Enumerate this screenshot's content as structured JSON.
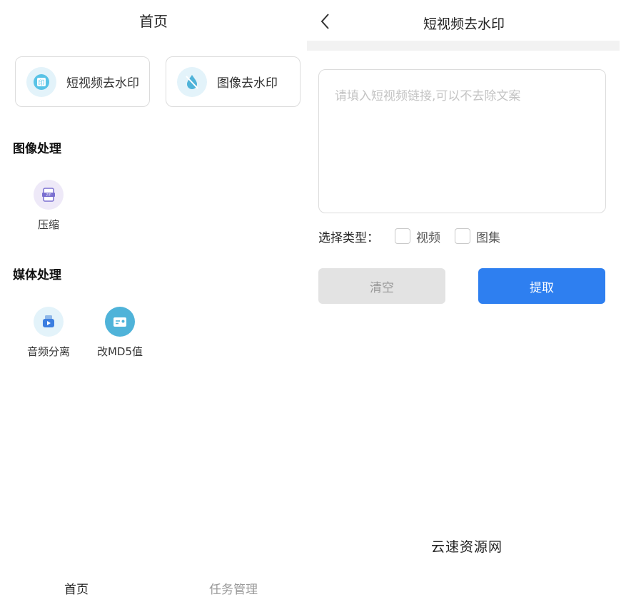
{
  "home": {
    "title": "首页",
    "cards": [
      {
        "label": "短视频去水印",
        "icon": "video-watermark-icon"
      },
      {
        "label": "图像去水印",
        "icon": "image-watermark-icon"
      }
    ],
    "sections": [
      {
        "title": "图像处理",
        "tools": [
          {
            "label": "压缩",
            "icon": "zip-compress-icon"
          }
        ]
      },
      {
        "title": "媒体处理",
        "tools": [
          {
            "label": "音频分离",
            "icon": "audio-split-icon"
          },
          {
            "label": "改MD5值",
            "icon": "md5-card-icon"
          }
        ]
      }
    ],
    "tabbar": {
      "home": "首页",
      "tasks": "任务管理"
    }
  },
  "video_watermark": {
    "title": "短视频去水印",
    "input_placeholder": "请填入短视频链接,可以不去除文案",
    "input_value": "",
    "type_label": "选择类型：",
    "types": [
      "视频",
      "图集"
    ],
    "clear_button": "清空",
    "extract_button": "提取",
    "watermark_text": "云速资源网"
  },
  "colors": {
    "primary": "#2e7ff0",
    "icon_bg_light_blue": "#e3f3fa",
    "icon_bg_lavender": "#eee9f8",
    "icon_bg_teal": "#4fb3d9",
    "disabled_button": "#e3e3e3",
    "inactive_tab": "#999999"
  }
}
